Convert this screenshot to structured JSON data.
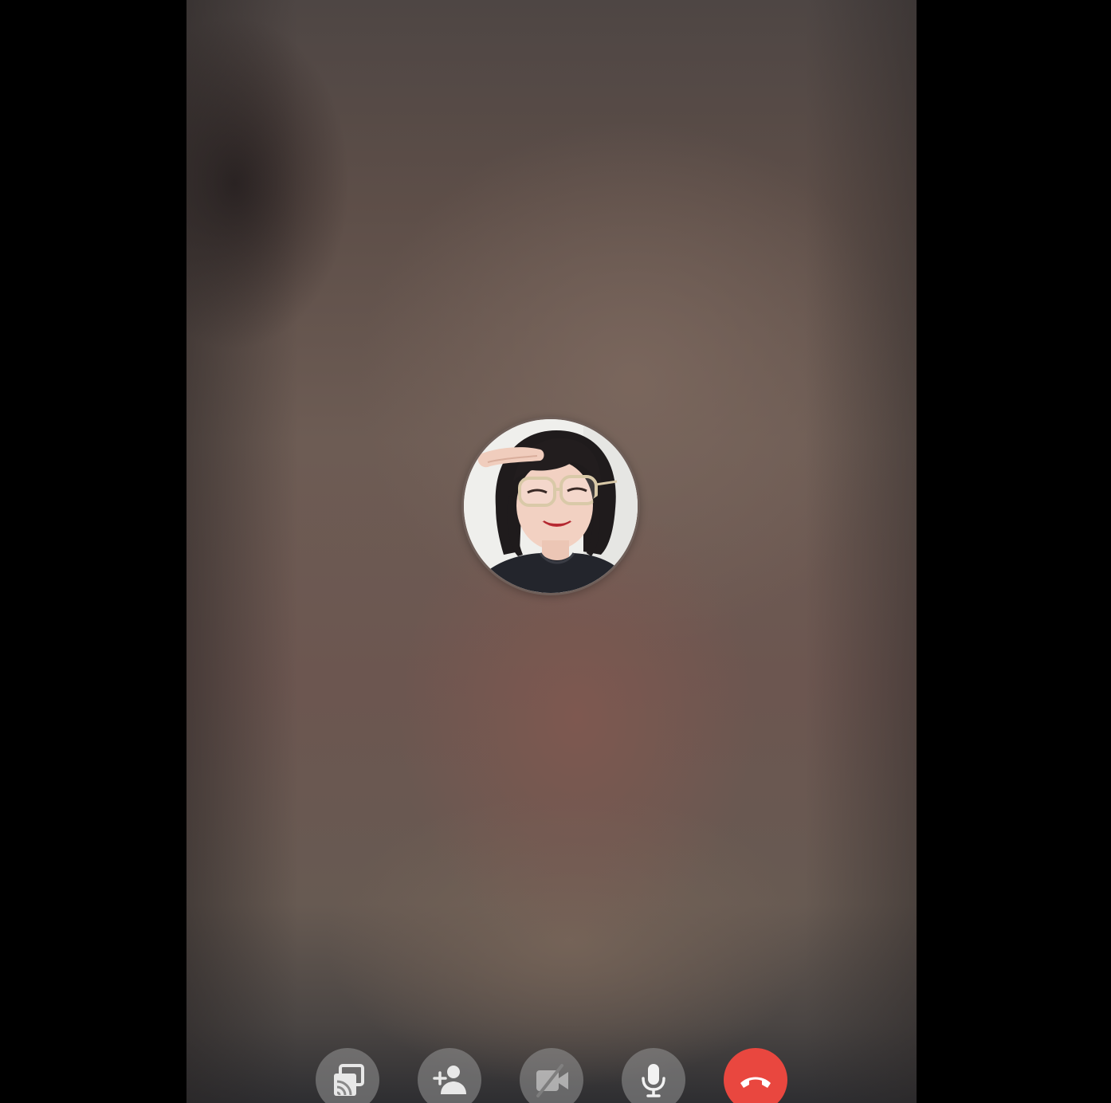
{
  "call": {
    "participant_avatar": "participant-profile-photo",
    "background_color": "#6b5852"
  },
  "controls": [
    {
      "name": "share-screen-button",
      "icon": "cast-screen-icon",
      "enabled": true
    },
    {
      "name": "add-person-button",
      "icon": "add-person-icon",
      "enabled": true
    },
    {
      "name": "video-off-button",
      "icon": "video-off-icon",
      "enabled": false
    },
    {
      "name": "microphone-button",
      "icon": "microphone-icon",
      "enabled": true
    },
    {
      "name": "end-call-button",
      "icon": "hang-up-icon",
      "enabled": true,
      "color": "#e9473f"
    }
  ]
}
